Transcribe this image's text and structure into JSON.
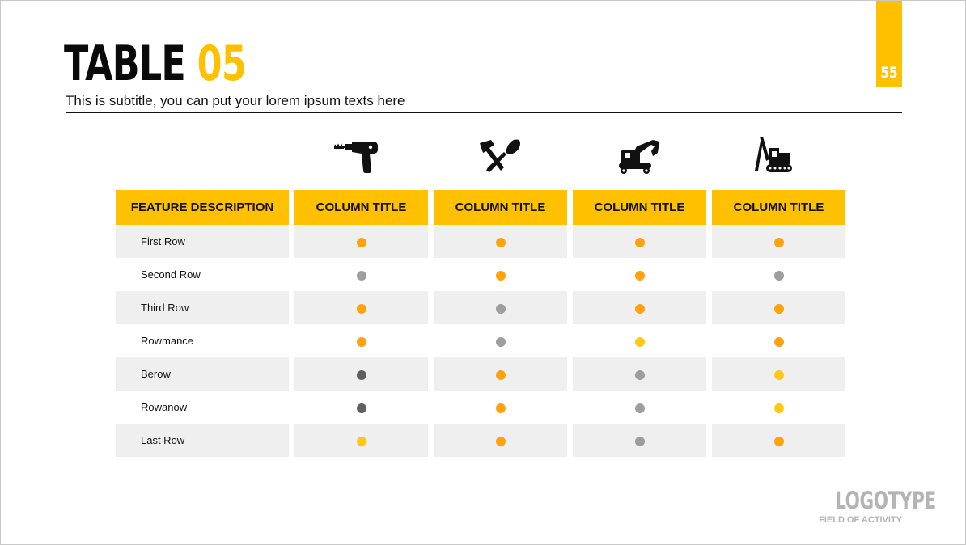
{
  "slide": {
    "title_part1": "TABLE ",
    "title_part2": "05",
    "subtitle": "This is subtitle, you can put your lorem ipsum texts here",
    "page_number": "55"
  },
  "colors": {
    "accent": "#FFC000",
    "orange": "#FFA20F",
    "yellow": "#FFC812",
    "gray": "#9E9E9E",
    "dark": "#5F5F5F",
    "row_alt": "#EFEFEF"
  },
  "icons": [
    "drill-icon",
    "hammer-trowel-icon",
    "excavator-icon",
    "crane-icon"
  ],
  "table": {
    "header_feature": "FEATURE DESCRIPTION",
    "columns": [
      "COLUMN TITLE",
      "COLUMN TITLE",
      "COLUMN TITLE",
      "COLUMN TITLE"
    ],
    "rows": [
      {
        "label": "First Row",
        "dots": [
          "orange",
          "orange",
          "orange",
          "orange"
        ]
      },
      {
        "label": "Second Row",
        "dots": [
          "gray",
          "orange",
          "orange",
          "gray"
        ]
      },
      {
        "label": "Third Row",
        "dots": [
          "orange",
          "gray",
          "orange",
          "orange"
        ]
      },
      {
        "label": "Rowmance",
        "dots": [
          "orange",
          "gray",
          "yellow",
          "orange"
        ]
      },
      {
        "label": "Berow",
        "dots": [
          "dark",
          "orange",
          "gray",
          "yellow"
        ]
      },
      {
        "label": "Rowanow",
        "dots": [
          "dark",
          "orange",
          "gray",
          "yellow"
        ]
      },
      {
        "label": "Last Row",
        "dots": [
          "yellow",
          "orange",
          "gray",
          "orange"
        ]
      }
    ]
  },
  "logo": {
    "main": "LOGOTYPE",
    "sub": "FIELD OF ACTIVITY"
  }
}
